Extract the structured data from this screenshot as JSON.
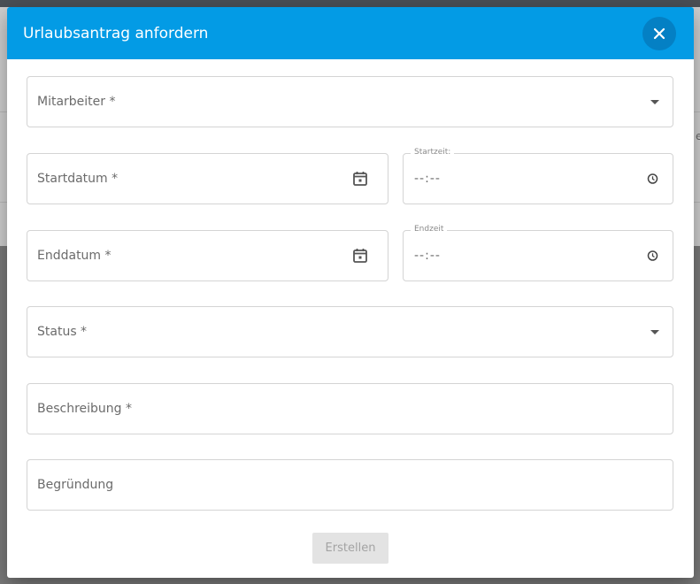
{
  "dialog": {
    "title": "Urlaubsantrag anfordern",
    "close_icon": "close-icon",
    "header_color": "#039be5"
  },
  "form": {
    "employee": {
      "label": "Mitarbeiter *",
      "icon": "dropdown-arrow-icon"
    },
    "start_date": {
      "label": "Startdatum *",
      "icon": "calendar-icon"
    },
    "start_time": {
      "label": "Startzeit:",
      "value": "--:--",
      "icon": "clock-icon"
    },
    "end_date": {
      "label": "Enddatum *",
      "icon": "calendar-icon"
    },
    "end_time": {
      "label": "Endzeit",
      "value": "--:--",
      "icon": "clock-icon"
    },
    "status": {
      "label": "Status *",
      "icon": "dropdown-arrow-icon"
    },
    "description": {
      "label": "Beschreibung *"
    },
    "reason": {
      "label": "Begründung"
    },
    "submit_label": "Erstellen"
  },
  "background": {
    "edge_text": "er"
  }
}
